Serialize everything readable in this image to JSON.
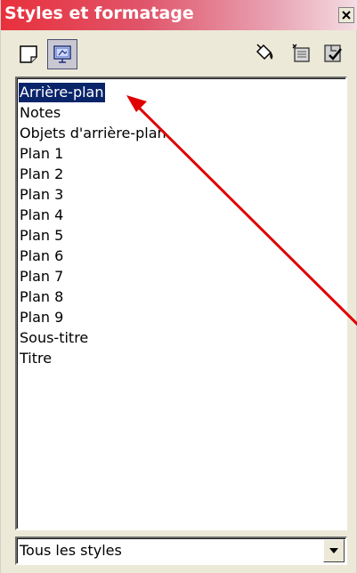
{
  "window": {
    "title": "Styles et formatage"
  },
  "toolbar": {
    "graphic_styles_icon": "rectangle-style-icon",
    "presentation_styles_icon": "presentation-style-icon",
    "fill_format_icon": "paint-bucket-icon",
    "new_style_icon": "new-style-from-selection-icon",
    "update_style_icon": "update-style-icon"
  },
  "styles_list": {
    "selected_index": 0,
    "items": [
      "Arrière-plan",
      "Notes",
      "Objets d'arrière-plan",
      "Plan 1",
      "Plan 2",
      "Plan 3",
      "Plan 4",
      "Plan 5",
      "Plan 6",
      "Plan 7",
      "Plan 8",
      "Plan 9",
      "Sous-titre",
      "Titre"
    ]
  },
  "filter": {
    "selected": "Tous les styles"
  },
  "colors": {
    "title_red": "#e8303c",
    "selection": "#0a246a",
    "annotation_arrow": "#e00000"
  }
}
